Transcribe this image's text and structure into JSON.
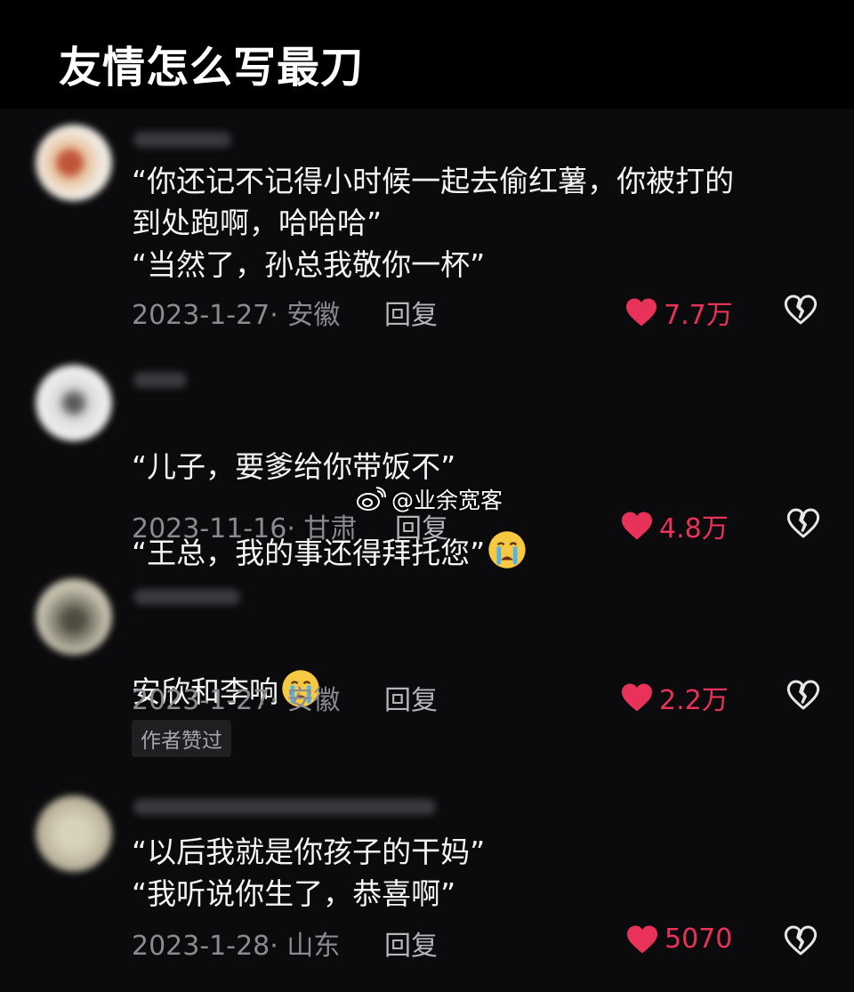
{
  "header": {
    "title": "友情怎么写最刀"
  },
  "comments": [
    {
      "text": "“你还记不记得小时候一起去偷红薯，你被打的\n到处跑啊，哈哈哈”\n“当然了，孙总我敬你一杯”",
      "date_location": "2023-1-27· 安徽",
      "reply_label": "回复",
      "likes": "7.7万"
    },
    {
      "text_line1": "“儿子，要爹给你带饭不”",
      "text_line2": "“王总，我的事还得拜托您”",
      "emoji": "crying-face",
      "date_location": "2023-11-16· 甘肃",
      "reply_label": "回复",
      "likes": "4.8万"
    },
    {
      "text": "安欣和李响",
      "emoji": "crying-face",
      "date_location": "2023-1-27· 安徽",
      "reply_label": "回复",
      "likes": "2.2万",
      "badge": "作者赞过"
    },
    {
      "text": "“以后我就是你孩子的干妈”\n“我听说你生了，恭喜啊”",
      "date_location": "2023-1-28· 山东",
      "reply_label": "回复",
      "likes": "5070"
    }
  ],
  "watermark": {
    "text": "@业余宽客",
    "icon": "weibo-icon"
  },
  "colors": {
    "background": "#0b0b0d",
    "like": "#e8325a",
    "meta": "#8a8a8f"
  }
}
